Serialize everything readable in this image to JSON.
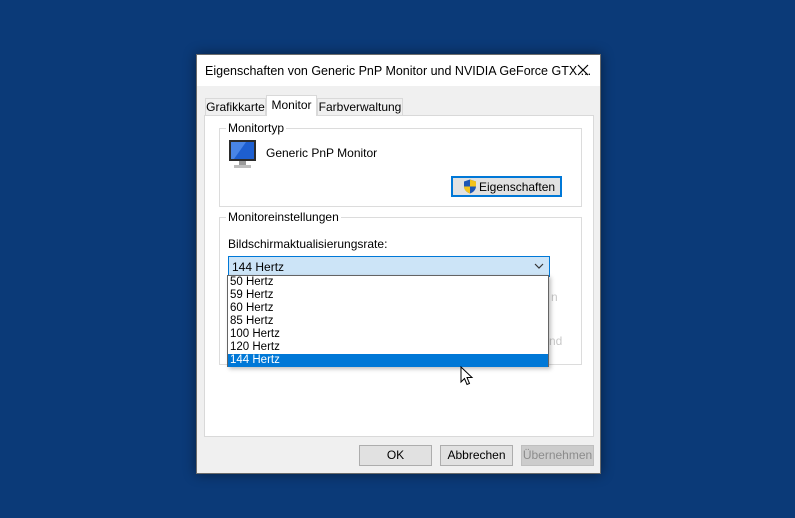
{
  "window": {
    "title": "Eigenschaften von Generic PnP Monitor und NVIDIA GeForce GTX ..."
  },
  "tabs": [
    {
      "label": "Grafikkarte",
      "active": false
    },
    {
      "label": "Monitor",
      "active": true
    },
    {
      "label": "Farbverwaltung",
      "active": false
    }
  ],
  "monitor_type": {
    "group_label": "Monitortyp",
    "monitor_name": "Generic PnP Monitor",
    "properties_button": "Eigenschaften",
    "monitor_icon": "monitor-icon",
    "shield_icon": "uac-shield-icon"
  },
  "monitor_settings": {
    "group_label": "Monitoreinstellungen",
    "refresh_label": "Bildschirmaktualisierungsrate:",
    "refresh_selected": "144 Hertz",
    "refresh_options": [
      "50 Hertz",
      "59 Hertz",
      "60 Hertz",
      "85 Hertz",
      "100 Hertz",
      "120 Hertz",
      "144 Hertz"
    ],
    "hidden_text_fragments": [
      "n",
      "nd"
    ]
  },
  "footer": {
    "ok": "OK",
    "cancel": "Abbrechen",
    "apply": "Übernehmen"
  },
  "colors": {
    "desktop": "#0b3a78",
    "accent": "#0078d7",
    "select_bg": "#cce4f7"
  }
}
